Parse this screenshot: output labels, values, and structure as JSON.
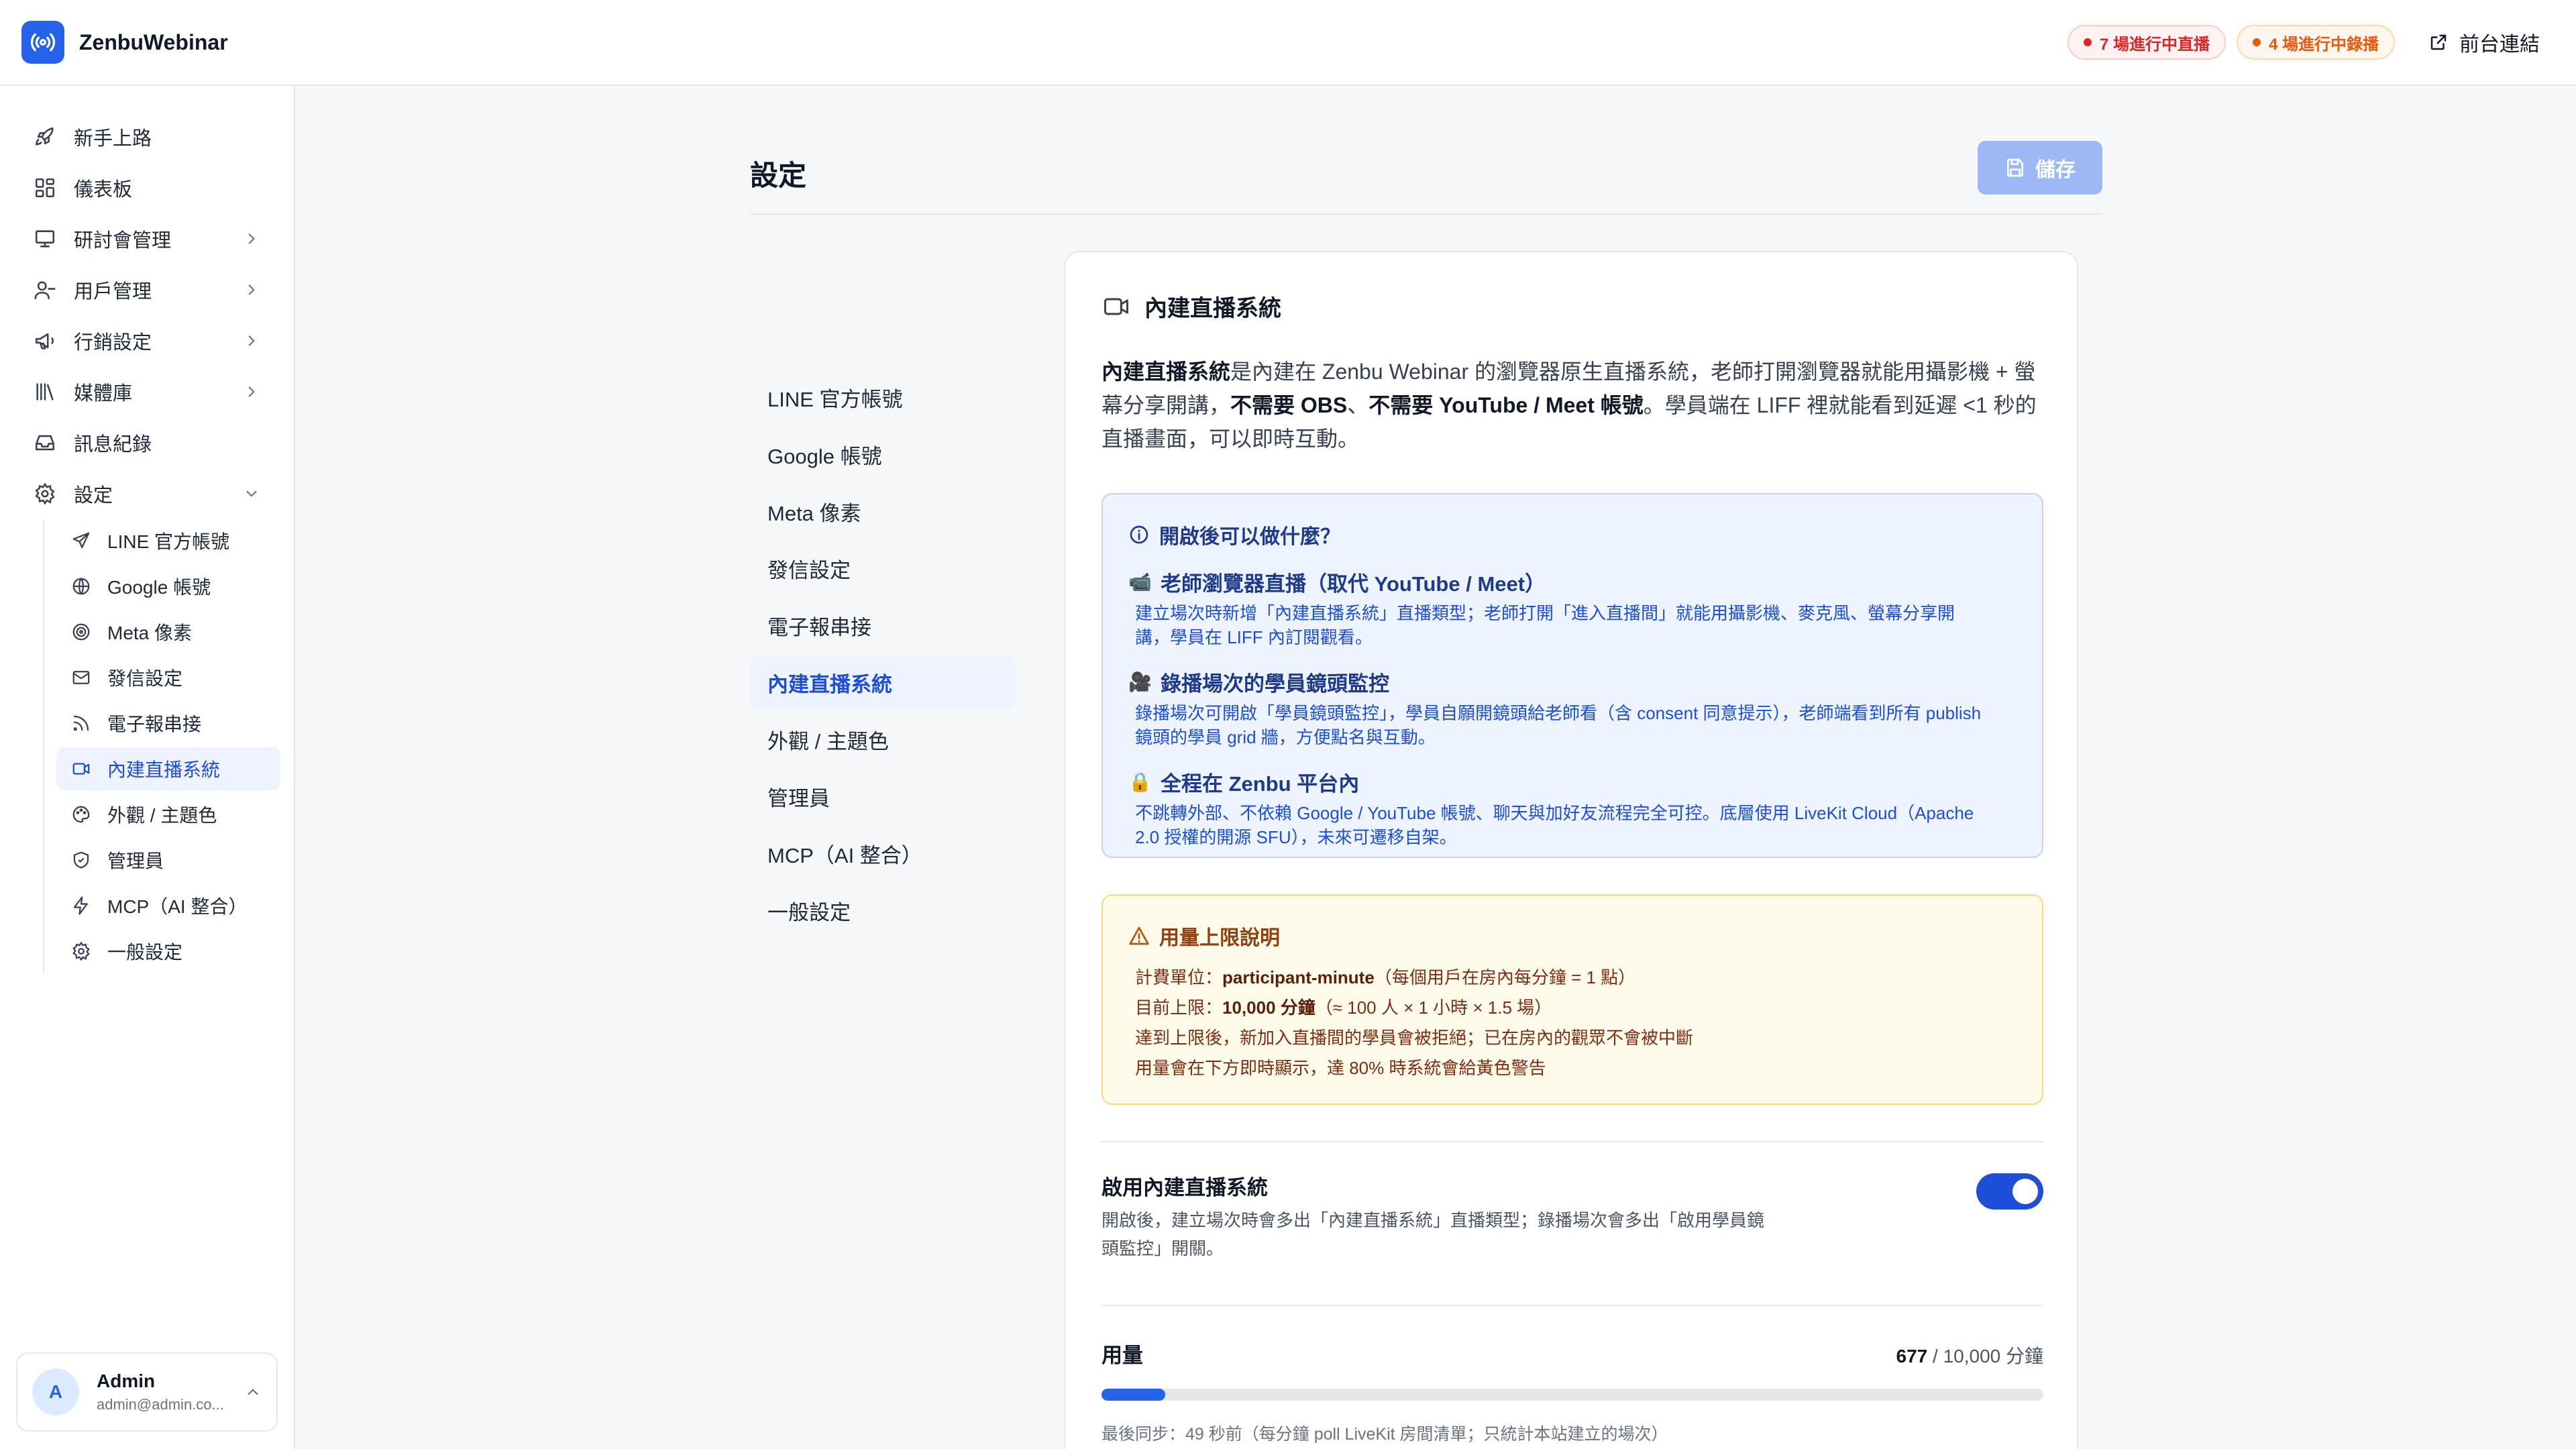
{
  "app": {
    "name": "ZenbuWebinar"
  },
  "header": {
    "live_badge": "7 場進行中直播",
    "recording_badge": "4 場進行中錄播",
    "front_link": "前台連結"
  },
  "sidebar": {
    "items": [
      {
        "label": "新手上路",
        "icon": "rocket-icon"
      },
      {
        "label": "儀表板",
        "icon": "dashboard-icon"
      },
      {
        "label": "研討會管理",
        "icon": "presentation-icon",
        "expandable": true
      },
      {
        "label": "用戶管理",
        "icon": "users-icon",
        "expandable": true
      },
      {
        "label": "行銷設定",
        "icon": "megaphone-icon",
        "expandable": true
      },
      {
        "label": "媒體庫",
        "icon": "library-icon",
        "expandable": true
      },
      {
        "label": "訊息紀錄",
        "icon": "inbox-icon"
      },
      {
        "label": "設定",
        "icon": "gear-icon",
        "expanded": true
      }
    ],
    "settings_children": [
      {
        "label": "LINE 官方帳號",
        "icon": "send-icon"
      },
      {
        "label": "Google 帳號",
        "icon": "globe-icon"
      },
      {
        "label": "Meta 像素",
        "icon": "target-icon"
      },
      {
        "label": "發信設定",
        "icon": "mail-icon"
      },
      {
        "label": "電子報串接",
        "icon": "rss-icon"
      },
      {
        "label": "內建直播系統",
        "icon": "video-icon",
        "active": true
      },
      {
        "label": "外觀 / 主題色",
        "icon": "palette-icon"
      },
      {
        "label": "管理員",
        "icon": "shield-icon"
      },
      {
        "label": "MCP（AI 整合）",
        "icon": "zap-icon"
      },
      {
        "label": "一般設定",
        "icon": "cog-icon"
      }
    ],
    "user": {
      "initial": "A",
      "name": "Admin",
      "email": "admin@admin.co..."
    }
  },
  "page": {
    "title": "設定",
    "save_label": "儲存"
  },
  "settings_nav": [
    {
      "label": "LINE 官方帳號"
    },
    {
      "label": "Google 帳號"
    },
    {
      "label": "Meta 像素"
    },
    {
      "label": "發信設定"
    },
    {
      "label": "電子報串接"
    },
    {
      "label": "內建直播系統",
      "active": true
    },
    {
      "label": "外觀 / 主題色"
    },
    {
      "label": "管理員"
    },
    {
      "label": "MCP（AI 整合）"
    },
    {
      "label": "一般設定"
    }
  ],
  "card": {
    "title": "內建直播系統",
    "intro": {
      "p1": "內建直播系統",
      "p2": "是內建在 Zenbu Webinar 的瀏覽器原生直播系統，老師打開瀏覽器就能用攝影機 + 螢幕分享開講，",
      "p3": "不需要 OBS",
      "p4": "、",
      "p5": "不需要 YouTube / Meet 帳號",
      "p6": "。學員端在 LIFF 裡就能看到延遲 <1 秒的直播畫面，可以即時互動。"
    },
    "info": {
      "title": "開啟後可以做什麼？",
      "features": [
        {
          "emoji": "📹",
          "title": "老師瀏覽器直播（取代 YouTube / Meet）",
          "desc": "建立場次時新增「內建直播系統」直播類型；老師打開「進入直播間」就能用攝影機、麥克風、螢幕分享開講，學員在 LIFF 內訂閱觀看。"
        },
        {
          "emoji": "🎥",
          "title": "錄播場次的學員鏡頭監控",
          "desc": "錄播場次可開啟「學員鏡頭監控」，學員自願開鏡頭給老師看（含 consent 同意提示），老師端看到所有 publish 鏡頭的學員 grid 牆，方便點名與互動。"
        },
        {
          "emoji": "🔒",
          "title": "全程在 Zenbu 平台內",
          "desc": "不跳轉外部、不依賴 Google / YouTube 帳號、聊天與加好友流程完全可控。底層使用 LiveKit Cloud（Apache 2.0 授權的開源 SFU），未來可遷移自架。"
        }
      ]
    },
    "limits": {
      "title": "用量上限說明",
      "unit_label": "計費單位：",
      "unit_value": "participant-minute",
      "unit_note": "（每個用戶在房內每分鐘 = 1 點）",
      "cap_label": "目前上限：",
      "cap_value": "10,000 分鐘",
      "cap_note": "（≈ 100 人 × 1 小時 × 1.5 場）",
      "line3": "達到上限後，新加入直播間的學員會被拒絕；已在房內的觀眾不會被中斷",
      "line4": "用量會在下方即時顯示，達 80% 時系統會給黃色警告"
    },
    "toggle": {
      "title": "啟用內建直播系統",
      "desc": "開啟後，建立場次時會多出「內建直播系統」直播類型；錄播場次會多出「啟用學員鏡頭監控」開關。",
      "enabled": true
    },
    "usage": {
      "label": "用量",
      "used": "677",
      "separator": " / ",
      "limit": "10,000 分鐘",
      "fraction": 0.0677,
      "sync_note": "最後同步：49 秒前（每分鐘 poll LiveKit 房間清單；只統計本站建立的場次）"
    }
  },
  "colors": {
    "accent": "#2563eb",
    "live": "#dc2626",
    "recording": "#ea580c",
    "info_bg": "#eef4ff",
    "warn_bg": "#fffbea"
  }
}
